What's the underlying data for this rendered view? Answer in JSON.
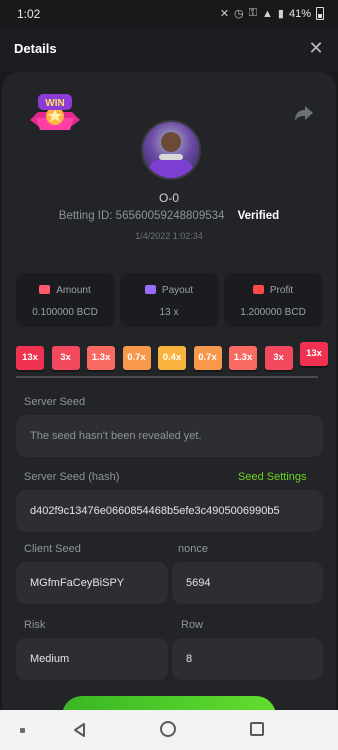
{
  "status_bar": {
    "time": "1:02",
    "battery": "41%"
  },
  "header": {
    "title": "Details",
    "close_glyph": "✕"
  },
  "bet": {
    "badge_text": "WIN",
    "username": "O-0",
    "betting_id": "Betting ID: 56560059248809534",
    "verified_label": "Verified",
    "date": "1/4/2022 1:02:34"
  },
  "stats": {
    "amount": {
      "label": "Amount",
      "value": "0.100000 BCD",
      "icon": "coins-icon",
      "color": "#ff5a6e"
    },
    "payout": {
      "label": "Payout",
      "value": "13 x",
      "icon": "card-icon",
      "color": "#9b6bff"
    },
    "profit": {
      "label": "Profit",
      "value": "1.200000 BCD",
      "icon": "money-hand-icon",
      "color": "#ff4a4a"
    }
  },
  "multipliers": [
    {
      "label": "13x",
      "color": "#f0314f"
    },
    {
      "label": "3x",
      "color": "#f3495e"
    },
    {
      "label": "1.3x",
      "color": "#f86a62"
    },
    {
      "label": "0.7x",
      "color": "#f7984c"
    },
    {
      "label": "0.4x",
      "color": "#f9b43e"
    },
    {
      "label": "0.7x",
      "color": "#f7984c"
    },
    {
      "label": "1.3x",
      "color": "#f86a62"
    },
    {
      "label": "3x",
      "color": "#f3495e"
    },
    {
      "label": "13x",
      "color": "#f0314f"
    }
  ],
  "seeds": {
    "server_seed_label": "Server Seed",
    "server_seed_value": "The seed hasn't been revealed yet.",
    "server_hash_label": "Server Seed (hash)",
    "seed_settings_label": "Seed Settings",
    "server_hash_value": "d402f9c13476e0660854468b5efe3c4905006990b5",
    "client_seed_label": "Client Seed",
    "client_seed_value": "MGfmFaCeyBiSPY",
    "nonce_label": "nonce",
    "nonce_value": "5694",
    "risk_label": "Risk",
    "risk_value": "Medium",
    "row_label": "Row",
    "row_value": "8"
  },
  "colors": {
    "accent_green": "#6ad41b",
    "background": "#18191b",
    "card": "#232427"
  }
}
